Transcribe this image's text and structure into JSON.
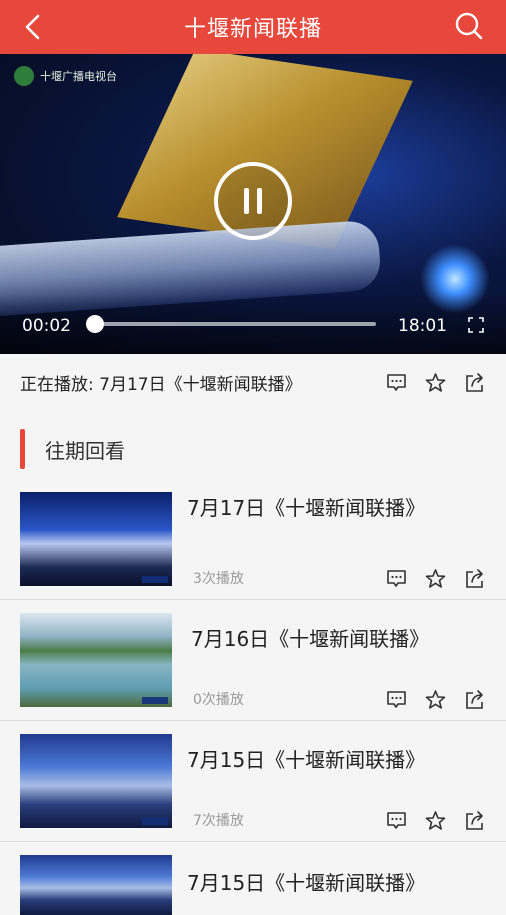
{
  "header": {
    "title": "十堰新闻联播",
    "back_icon": "chevron-left-icon",
    "search_icon": "search-icon"
  },
  "player": {
    "channel_logo_text": "十堰广播电视台",
    "current_time": "00:02",
    "total_time": "18:01",
    "progress": 0.002,
    "state": "playing"
  },
  "now_playing": {
    "label": "正在播放: 7月17日《十堰新闻联播》"
  },
  "section": {
    "title": "往期回看"
  },
  "episodes": [
    {
      "title": "7月17日《十堰新闻联播》",
      "plays": "3次播放"
    },
    {
      "title": "7月16日《十堰新闻联播》",
      "plays": "0次播放"
    },
    {
      "title": "7月15日《十堰新闻联播》",
      "plays": "7次播放"
    },
    {
      "title": "7月15日《十堰新闻联播》",
      "plays": ""
    }
  ],
  "colors": {
    "accent": "#e8473c"
  }
}
